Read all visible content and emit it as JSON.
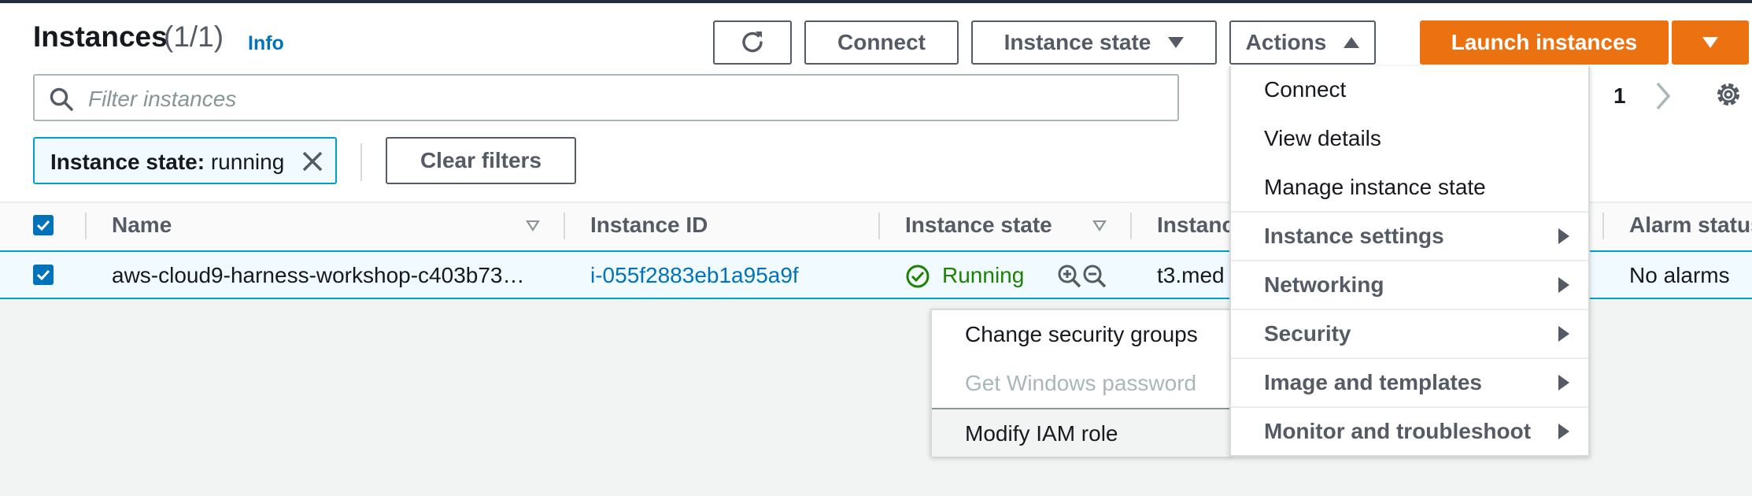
{
  "header": {
    "title": "Instances",
    "count": "(1/1)",
    "info_link": "Info"
  },
  "toolbar": {
    "refresh_icon": "refresh-icon",
    "connect_label": "Connect",
    "instance_state_label": "Instance state",
    "actions_label": "Actions",
    "launch_label": "Launch instances"
  },
  "search": {
    "placeholder": "Filter instances",
    "icon": "search-icon"
  },
  "pagination": {
    "page": "1"
  },
  "filters": {
    "chip_key": "Instance state:",
    "chip_value": "running",
    "clear_label": "Clear filters"
  },
  "table": {
    "columns": [
      "Name",
      "Instance ID",
      "Instance state",
      "Instanc",
      "Alarm status"
    ],
    "rows": [
      {
        "name": "aws-cloud9-harness-workshop-c403b73…",
        "instance_id": "i-055f2883eb1a95a9f",
        "state": "Running",
        "type": "t3.med",
        "alarm": "No alarms"
      }
    ]
  },
  "actions_menu": {
    "items": [
      {
        "label": "Connect",
        "type": "action"
      },
      {
        "label": "View details",
        "type": "action"
      },
      {
        "label": "Manage instance state",
        "type": "action"
      },
      {
        "label": "Instance settings",
        "type": "group"
      },
      {
        "label": "Networking",
        "type": "group"
      },
      {
        "label": "Security",
        "type": "group"
      },
      {
        "label": "Image and templates",
        "type": "group"
      },
      {
        "label": "Monitor and troubleshoot",
        "type": "group"
      }
    ]
  },
  "security_submenu": {
    "items": [
      {
        "label": "Change security groups",
        "state": "enabled"
      },
      {
        "label": "Get Windows password",
        "state": "disabled"
      },
      {
        "label": "Modify IAM role",
        "state": "hovered"
      }
    ]
  },
  "colors": {
    "primary": "#ec7211",
    "link": "#0073bb",
    "success": "#1d8102",
    "disabled": "#aab7b8"
  }
}
